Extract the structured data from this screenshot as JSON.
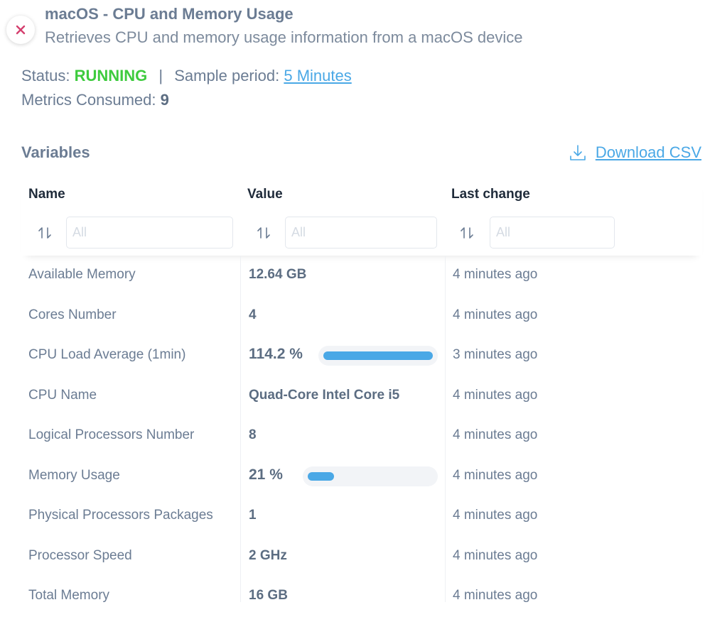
{
  "header": {
    "title": "macOS - CPU and Memory Usage",
    "subtitle": "Retrieves CPU and memory usage information from a macOS device"
  },
  "status": {
    "label": "Status:",
    "value": "RUNNING",
    "separator": "|",
    "sample_label": "Sample period:",
    "sample_value": "5 Minutes",
    "metrics_label": "Metrics Consumed:",
    "metrics_value": "9"
  },
  "section": {
    "title": "Variables",
    "download_label": "Download CSV"
  },
  "table": {
    "columns": [
      {
        "label": "Name",
        "filter_placeholder": "All"
      },
      {
        "label": "Value",
        "filter_placeholder": "All"
      },
      {
        "label": "Last change",
        "filter_placeholder": "All"
      }
    ],
    "rows": [
      {
        "name": "Available Memory",
        "value": "12.64 GB",
        "change": "4 minutes ago"
      },
      {
        "name": "Cores Number",
        "value": "4",
        "change": "4 minutes ago"
      },
      {
        "name": "CPU Load Average (1min)",
        "value": "114.2 %",
        "change": "3 minutes ago",
        "bar_fraction": 1.0
      },
      {
        "name": "CPU Name",
        "value": "Quad-Core Intel Core i5",
        "change": "4 minutes ago"
      },
      {
        "name": "Logical Processors Number",
        "value": "8",
        "change": "4 minutes ago"
      },
      {
        "name": "Memory Usage",
        "value": "21 %",
        "change": "4 minutes ago",
        "bar_fraction": 0.21
      },
      {
        "name": "Physical Processors Packages",
        "value": "1",
        "change": "4 minutes ago"
      },
      {
        "name": "Processor Speed",
        "value": "2 GHz",
        "change": "4 minutes ago"
      },
      {
        "name": "Total Memory",
        "value": "16 GB",
        "change": "4 minutes ago"
      }
    ]
  },
  "colors": {
    "running": "#3ecb3e",
    "link": "#4aa8e6",
    "close": "#d43f6e",
    "bar": "#4aa8e6"
  },
  "icons": {
    "close": "close-icon",
    "download": "download-icon",
    "sort": "sort-icon"
  }
}
